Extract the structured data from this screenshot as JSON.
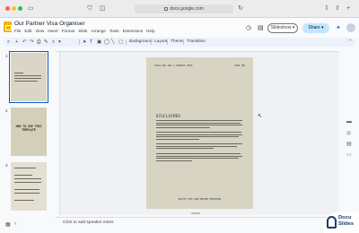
{
  "browser": {
    "url": "docs.google.com",
    "colors": {
      "close": "#ff5f57",
      "minimize": "#febc2e",
      "zoom": "#28c840"
    }
  },
  "doc": {
    "title": "Our Partner Visa Organiser",
    "menu": [
      "File",
      "Edit",
      "View",
      "Insert",
      "Format",
      "Slide",
      "Arrange",
      "Tools",
      "Extensions",
      "Help"
    ],
    "slideshow_label": "Slideshow",
    "share_label": "Share"
  },
  "toolbar": {
    "background_label": "Background",
    "layout_label": "Layout",
    "theme_label": "Theme",
    "transition_label": "Transition"
  },
  "filmstrip": {
    "slides": [
      {
        "number": "1",
        "selected": true
      },
      {
        "number": "2",
        "selected": false,
        "title": "HOW TO USE THIS TEMPLATE"
      },
      {
        "number": "3",
        "selected": false
      }
    ]
  },
  "slide": {
    "header_left": "SPELLING AND A WONDER HERE",
    "header_right": "PAGE TWO",
    "heading": "DISCLAIMER",
    "footer": "DELETE THIS PAGE BEFORE EXPORTING"
  },
  "notes": {
    "placeholder": "Click to add speaker notes"
  },
  "brand": {
    "line1": "Docu",
    "line2": "Slides",
    "color": "#1d3b6b"
  },
  "accent": "#0b57d0"
}
